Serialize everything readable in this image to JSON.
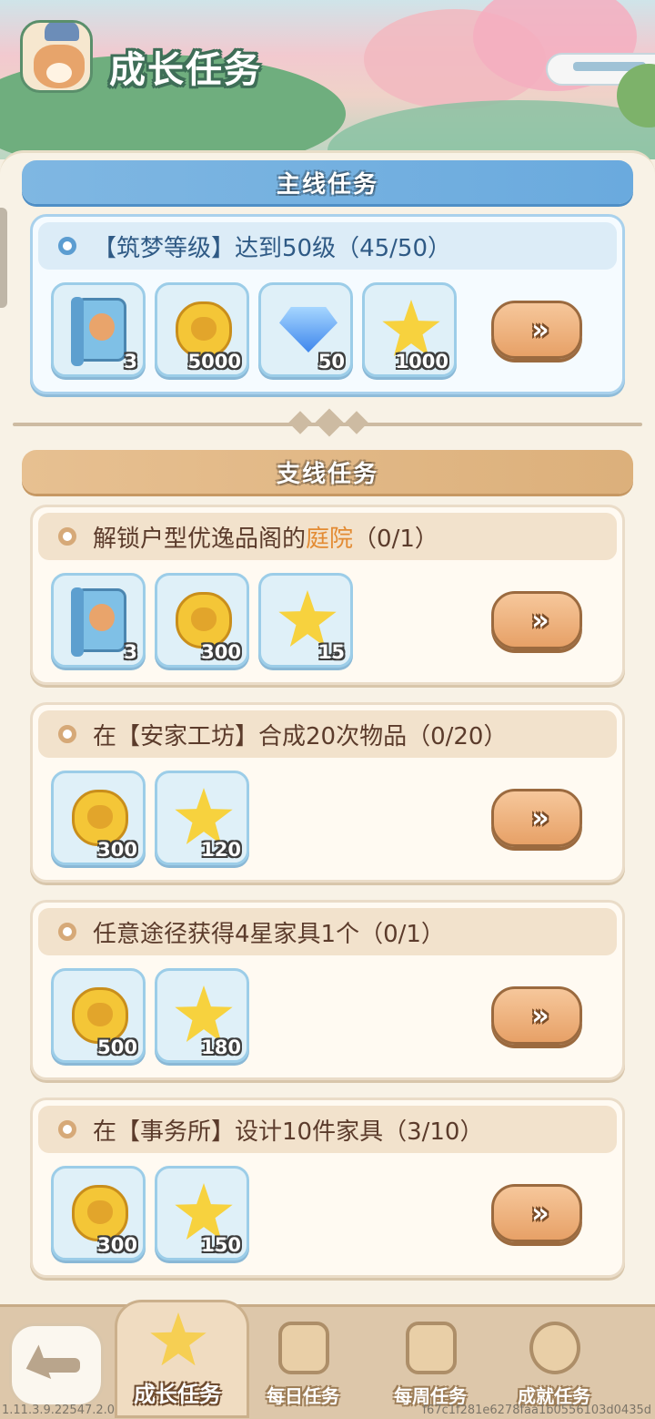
{
  "header": {
    "title": "成长任务"
  },
  "main_section": {
    "label": "主线任务"
  },
  "side_section": {
    "label": "支线任务"
  },
  "main_task": {
    "title": "【筑梦等级】达到50级（45/50）",
    "rewards": [
      {
        "icon": "blueprint-book-icon",
        "amount": "3"
      },
      {
        "icon": "cat-coin-icon",
        "amount": "5000"
      },
      {
        "icon": "diamond-icon",
        "amount": "50"
      },
      {
        "icon": "star-icon",
        "amount": "1000"
      }
    ]
  },
  "side_tasks": [
    {
      "title_pre": "解锁户型优逸品阁的",
      "title_hl": "庭院",
      "title_post": "（0/1）",
      "rewards": [
        {
          "icon": "blueprint-book-icon",
          "amount": "3"
        },
        {
          "icon": "cat-coin-icon",
          "amount": "300"
        },
        {
          "icon": "star-icon",
          "amount": "15"
        }
      ]
    },
    {
      "title_pre": "在【安家工坊】合成20次物品（0/20）",
      "title_hl": "",
      "title_post": "",
      "rewards": [
        {
          "icon": "cat-coin-icon",
          "amount": "300"
        },
        {
          "icon": "star-icon",
          "amount": "120"
        }
      ]
    },
    {
      "title_pre": "任意途径获得4星家具1个（0/1）",
      "title_hl": "",
      "title_post": "",
      "rewards": [
        {
          "icon": "cat-coin-icon",
          "amount": "500"
        },
        {
          "icon": "star-icon",
          "amount": "180"
        }
      ]
    },
    {
      "title_pre": "在【事务所】设计10件家具（3/10）",
      "title_hl": "",
      "title_post": "",
      "rewards": [
        {
          "icon": "cat-coin-icon",
          "amount": "300"
        },
        {
          "icon": "star-icon",
          "amount": "150"
        }
      ]
    }
  ],
  "go_button": {
    "label": "»",
    "color": "#e7a167"
  },
  "nav": {
    "tabs": [
      {
        "label": "成长任务",
        "icon": "star-trophy-icon",
        "active": true
      },
      {
        "label": "每日任务",
        "icon": "daily-calendar-icon",
        "active": false
      },
      {
        "label": "每周任务",
        "icon": "weekly-calendar-icon",
        "active": false
      },
      {
        "label": "成就任务",
        "icon": "achievement-house-icon",
        "active": false
      }
    ]
  },
  "footer": {
    "version": "1.11.3.9.22547.2.0",
    "hash": "f67c1f281e6278faa1b0556103d0435d"
  },
  "colors": {
    "main_banner": "#6aaade",
    "side_banner": "#dcb07b",
    "highlight": "#e38b33"
  }
}
